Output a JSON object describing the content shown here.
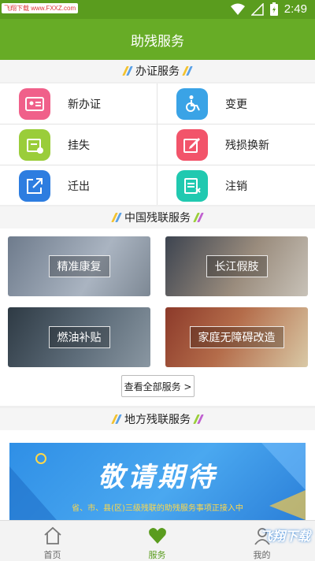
{
  "status_bar": {
    "watermark": "飞翔下载 www.FXXZ.com",
    "time": "2:49"
  },
  "header": {
    "title": "助残服务"
  },
  "sections": {
    "certificate": "办证服务",
    "china": "中国残联服务",
    "local": "地方残联服务"
  },
  "certificate_items": [
    {
      "label": "新办证",
      "icon": "id-card-icon",
      "color": "#f0608a"
    },
    {
      "label": "变更",
      "icon": "wheelchair-icon",
      "color": "#3aa3e6"
    },
    {
      "label": "挂失",
      "icon": "register-icon",
      "color": "#9acd3a"
    },
    {
      "label": "残损换新",
      "icon": "edit-icon",
      "color": "#f2546a"
    },
    {
      "label": "迁出",
      "icon": "export-icon",
      "color": "#2d7de0"
    },
    {
      "label": "注销",
      "icon": "cancel-document-icon",
      "color": "#20c9b0"
    }
  ],
  "china_services": [
    {
      "label": "精准康复",
      "color": "#8a97a8"
    },
    {
      "label": "长江假肢",
      "color": "#9a8c7d"
    },
    {
      "label": "燃油补贴",
      "color": "#5e6d7a"
    },
    {
      "label": "家庭无障碍改造",
      "color": "#b46c4a"
    }
  ],
  "more_button": "查看全部服务 >",
  "banner": {
    "title": "敬请期待",
    "subtitle": "省、市、县(区)三级残联的助残服务事项正接入中"
  },
  "tabs": [
    {
      "label": "首页",
      "icon": "home-icon"
    },
    {
      "label": "服务",
      "icon": "heart-icon"
    },
    {
      "label": "我的",
      "icon": "user-icon"
    }
  ],
  "tabbar_watermark": "飞翔下载",
  "accent_color": "#67ac26"
}
